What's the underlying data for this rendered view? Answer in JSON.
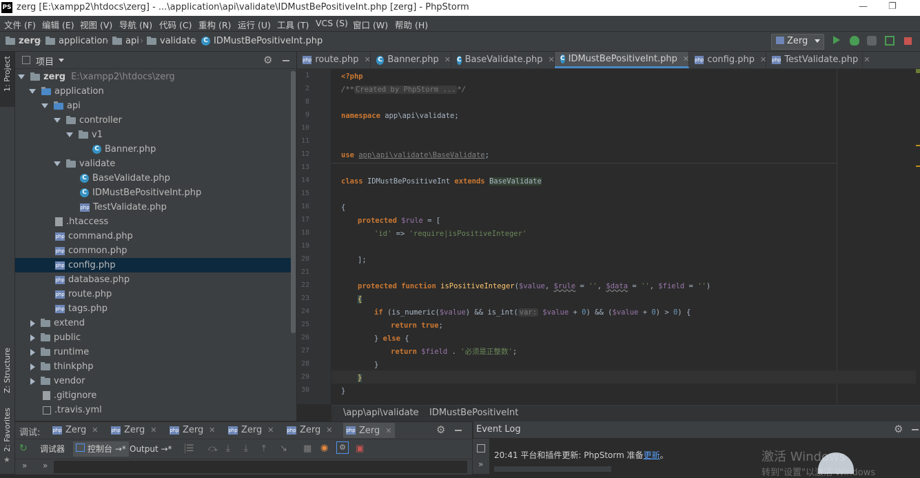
{
  "window": {
    "title": "zerg [E:\\xampp2\\htdocs\\zerg] - ...\\application\\api\\validate\\IDMustBePositiveInt.php [zerg] - PhpStorm",
    "logo": "PS",
    "minimize": "—",
    "restore": "❐"
  },
  "menu": [
    "文件 (F)",
    "编辑 (E)",
    "视图 (V)",
    "导航 (N)",
    "代码 (C)",
    "重构 (R)",
    "运行 (U)",
    "工具 (T)",
    "VCS (S)",
    "窗口 (W)",
    "帮助 (H)"
  ],
  "breadcrumb": [
    "zerg",
    "application",
    "api",
    "validate",
    "IDMustBePositiveInt.php"
  ],
  "run_config": "Zerg",
  "left_stripe": {
    "project": "1: Project",
    "structure": "Z: Structure",
    "favorites": "2: Favorites"
  },
  "project_panel": {
    "title": "项目",
    "tree": [
      {
        "label": "zerg",
        "path": "E:\\xampp2\\htdocs\\zerg",
        "type": "folder",
        "expanded": true
      },
      {
        "label": "application",
        "type": "folder",
        "expanded": true
      },
      {
        "label": "api",
        "type": "folder",
        "expanded": true
      },
      {
        "label": "controller",
        "type": "folder",
        "expanded": true
      },
      {
        "label": "v1",
        "type": "folder",
        "expanded": true
      },
      {
        "label": "Banner.php",
        "type": "class"
      },
      {
        "label": "validate",
        "type": "folder",
        "expanded": true
      },
      {
        "label": "BaseValidate.php",
        "type": "class"
      },
      {
        "label": "IDMustBePositiveInt.php",
        "type": "class"
      },
      {
        "label": "TestValidate.php",
        "type": "php"
      },
      {
        "label": ".htaccess",
        "type": "file"
      },
      {
        "label": "command.php",
        "type": "php"
      },
      {
        "label": "common.php",
        "type": "php"
      },
      {
        "label": "config.php",
        "type": "php",
        "selected": true
      },
      {
        "label": "database.php",
        "type": "php"
      },
      {
        "label": "route.php",
        "type": "php"
      },
      {
        "label": "tags.php",
        "type": "php"
      },
      {
        "label": "extend",
        "type": "folder",
        "expanded": false
      },
      {
        "label": "public",
        "type": "folder",
        "expanded": false
      },
      {
        "label": "runtime",
        "type": "folder",
        "expanded": false
      },
      {
        "label": "thinkphp",
        "type": "folder",
        "expanded": false
      },
      {
        "label": "vendor",
        "type": "folder",
        "expanded": false
      },
      {
        "label": ".gitignore",
        "type": "file"
      },
      {
        "label": ".travis.yml",
        "type": "file"
      }
    ]
  },
  "editor_tabs": [
    {
      "label": "route.php",
      "type": "php"
    },
    {
      "label": "Banner.php",
      "type": "class"
    },
    {
      "label": "BaseValidate.php",
      "type": "class"
    },
    {
      "label": "IDMustBePositiveInt.php",
      "type": "class",
      "active": true
    },
    {
      "label": "config.php",
      "type": "php"
    },
    {
      "label": "TestValidate.php",
      "type": "php"
    }
  ],
  "code": {
    "line_numbers": [
      "1",
      "2",
      "8",
      "9",
      "10",
      "11",
      "12",
      "13",
      "14",
      "15",
      "16",
      "17",
      "18",
      "19",
      "20",
      "21",
      "22",
      "23",
      "24",
      "25",
      "26",
      "27",
      "28",
      "29",
      "30"
    ],
    "php_open": "<?php",
    "comment_fold": "/**",
    "comment_text": "Created by PhpStorm ...",
    "comment_end": "*/",
    "namespace_kw": "namespace",
    "namespace_val": "app\\api\\validate;",
    "use_kw": "use",
    "use_val": "app\\api\\validate\\BaseValidate",
    "class_kw": "class",
    "class_name": "IDMustBePositiveInt",
    "extends_kw": "extends",
    "parent_class": "BaseValidate",
    "rule_line": "protected $rule = [",
    "rule_entry_key": "'id'",
    "rule_entry_val": "'require|isPositiveInteger'",
    "func_name": "isPositiveInteger",
    "hint": "var:",
    "field_msg": "'必须是正整数'"
  },
  "editor_breadcrumb": [
    "\\app\\api\\validate",
    "IDMustBePositiveInt"
  ],
  "debug": {
    "label": "调试:",
    "tabs": [
      "Zerg",
      "Zerg",
      "Zerg",
      "Zerg",
      "Zerg",
      "Zerg"
    ],
    "subtabs": [
      "调试器",
      "控制台 →*",
      "Output →*"
    ]
  },
  "event_log": {
    "title": "Event Log",
    "time": "20:41",
    "message": "平台和插件更新: PhpStorm 准备",
    "link": "更新",
    "tail": "。"
  },
  "watermark": {
    "line1": "激活 Windows",
    "line2": "转到\"设置\"以激活 Windows"
  },
  "colors": {
    "keyword": "#cc7832",
    "string": "#6a8759",
    "variable": "#9876aa",
    "function": "#ffc66d",
    "accent": "#4a88c7"
  }
}
